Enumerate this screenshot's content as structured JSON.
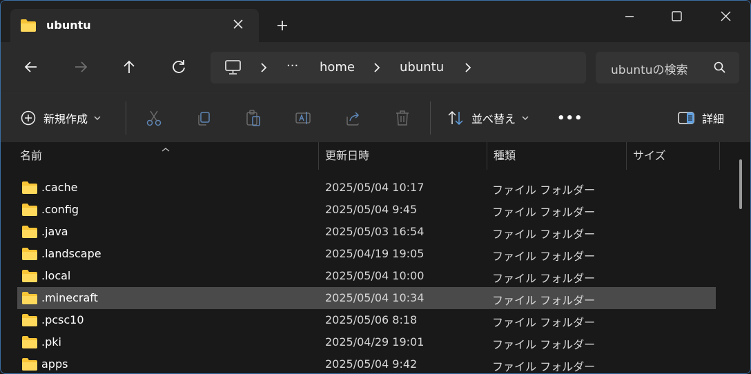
{
  "window": {
    "tab_title": "ubuntu",
    "accent_color": "#3b6ea5"
  },
  "address": {
    "ellipsis": "···",
    "crumbs": [
      "home",
      "ubuntu"
    ]
  },
  "search": {
    "placeholder": "ubuntuの検索"
  },
  "toolbar": {
    "new_label": "新規作成",
    "sort_label": "並べ替え",
    "more_label": "•••",
    "details_label": "詳細"
  },
  "columns": {
    "name": "名前",
    "modified": "更新日時",
    "type": "種類",
    "size": "サイズ"
  },
  "files": [
    {
      "name": ".cache",
      "modified": "2025/05/04 10:17",
      "type": "ファイル フォルダー",
      "selected": false
    },
    {
      "name": ".config",
      "modified": "2025/05/04 9:45",
      "type": "ファイル フォルダー",
      "selected": false
    },
    {
      "name": ".java",
      "modified": "2025/05/03 16:54",
      "type": "ファイル フォルダー",
      "selected": false
    },
    {
      "name": ".landscape",
      "modified": "2025/04/19 19:05",
      "type": "ファイル フォルダー",
      "selected": false
    },
    {
      "name": ".local",
      "modified": "2025/05/04 10:00",
      "type": "ファイル フォルダー",
      "selected": false
    },
    {
      "name": ".minecraft",
      "modified": "2025/05/04 10:34",
      "type": "ファイル フォルダー",
      "selected": true
    },
    {
      "name": ".pcsc10",
      "modified": "2025/05/06 8:18",
      "type": "ファイル フォルダー",
      "selected": false
    },
    {
      "name": ".pki",
      "modified": "2025/04/29 19:01",
      "type": "ファイル フォルダー",
      "selected": false
    },
    {
      "name": "apps",
      "modified": "2025/05/04 9:42",
      "type": "ファイル フォルダー",
      "selected": false
    }
  ]
}
